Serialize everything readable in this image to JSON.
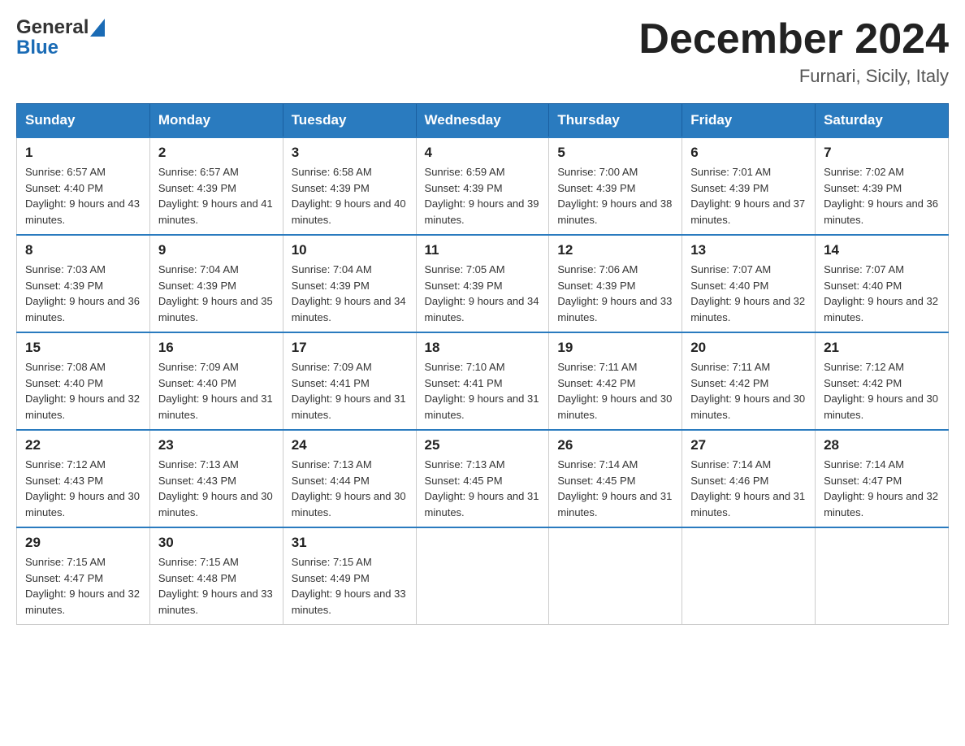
{
  "header": {
    "logo_text_general": "General",
    "logo_text_blue": "Blue",
    "month_title": "December 2024",
    "location": "Furnari, Sicily, Italy"
  },
  "days_of_week": [
    "Sunday",
    "Monday",
    "Tuesday",
    "Wednesday",
    "Thursday",
    "Friday",
    "Saturday"
  ],
  "weeks": [
    [
      {
        "day": "1",
        "sunrise": "Sunrise: 6:57 AM",
        "sunset": "Sunset: 4:40 PM",
        "daylight": "Daylight: 9 hours and 43 minutes."
      },
      {
        "day": "2",
        "sunrise": "Sunrise: 6:57 AM",
        "sunset": "Sunset: 4:39 PM",
        "daylight": "Daylight: 9 hours and 41 minutes."
      },
      {
        "day": "3",
        "sunrise": "Sunrise: 6:58 AM",
        "sunset": "Sunset: 4:39 PM",
        "daylight": "Daylight: 9 hours and 40 minutes."
      },
      {
        "day": "4",
        "sunrise": "Sunrise: 6:59 AM",
        "sunset": "Sunset: 4:39 PM",
        "daylight": "Daylight: 9 hours and 39 minutes."
      },
      {
        "day": "5",
        "sunrise": "Sunrise: 7:00 AM",
        "sunset": "Sunset: 4:39 PM",
        "daylight": "Daylight: 9 hours and 38 minutes."
      },
      {
        "day": "6",
        "sunrise": "Sunrise: 7:01 AM",
        "sunset": "Sunset: 4:39 PM",
        "daylight": "Daylight: 9 hours and 37 minutes."
      },
      {
        "day": "7",
        "sunrise": "Sunrise: 7:02 AM",
        "sunset": "Sunset: 4:39 PM",
        "daylight": "Daylight: 9 hours and 36 minutes."
      }
    ],
    [
      {
        "day": "8",
        "sunrise": "Sunrise: 7:03 AM",
        "sunset": "Sunset: 4:39 PM",
        "daylight": "Daylight: 9 hours and 36 minutes."
      },
      {
        "day": "9",
        "sunrise": "Sunrise: 7:04 AM",
        "sunset": "Sunset: 4:39 PM",
        "daylight": "Daylight: 9 hours and 35 minutes."
      },
      {
        "day": "10",
        "sunrise": "Sunrise: 7:04 AM",
        "sunset": "Sunset: 4:39 PM",
        "daylight": "Daylight: 9 hours and 34 minutes."
      },
      {
        "day": "11",
        "sunrise": "Sunrise: 7:05 AM",
        "sunset": "Sunset: 4:39 PM",
        "daylight": "Daylight: 9 hours and 34 minutes."
      },
      {
        "day": "12",
        "sunrise": "Sunrise: 7:06 AM",
        "sunset": "Sunset: 4:39 PM",
        "daylight": "Daylight: 9 hours and 33 minutes."
      },
      {
        "day": "13",
        "sunrise": "Sunrise: 7:07 AM",
        "sunset": "Sunset: 4:40 PM",
        "daylight": "Daylight: 9 hours and 32 minutes."
      },
      {
        "day": "14",
        "sunrise": "Sunrise: 7:07 AM",
        "sunset": "Sunset: 4:40 PM",
        "daylight": "Daylight: 9 hours and 32 minutes."
      }
    ],
    [
      {
        "day": "15",
        "sunrise": "Sunrise: 7:08 AM",
        "sunset": "Sunset: 4:40 PM",
        "daylight": "Daylight: 9 hours and 32 minutes."
      },
      {
        "day": "16",
        "sunrise": "Sunrise: 7:09 AM",
        "sunset": "Sunset: 4:40 PM",
        "daylight": "Daylight: 9 hours and 31 minutes."
      },
      {
        "day": "17",
        "sunrise": "Sunrise: 7:09 AM",
        "sunset": "Sunset: 4:41 PM",
        "daylight": "Daylight: 9 hours and 31 minutes."
      },
      {
        "day": "18",
        "sunrise": "Sunrise: 7:10 AM",
        "sunset": "Sunset: 4:41 PM",
        "daylight": "Daylight: 9 hours and 31 minutes."
      },
      {
        "day": "19",
        "sunrise": "Sunrise: 7:11 AM",
        "sunset": "Sunset: 4:42 PM",
        "daylight": "Daylight: 9 hours and 30 minutes."
      },
      {
        "day": "20",
        "sunrise": "Sunrise: 7:11 AM",
        "sunset": "Sunset: 4:42 PM",
        "daylight": "Daylight: 9 hours and 30 minutes."
      },
      {
        "day": "21",
        "sunrise": "Sunrise: 7:12 AM",
        "sunset": "Sunset: 4:42 PM",
        "daylight": "Daylight: 9 hours and 30 minutes."
      }
    ],
    [
      {
        "day": "22",
        "sunrise": "Sunrise: 7:12 AM",
        "sunset": "Sunset: 4:43 PM",
        "daylight": "Daylight: 9 hours and 30 minutes."
      },
      {
        "day": "23",
        "sunrise": "Sunrise: 7:13 AM",
        "sunset": "Sunset: 4:43 PM",
        "daylight": "Daylight: 9 hours and 30 minutes."
      },
      {
        "day": "24",
        "sunrise": "Sunrise: 7:13 AM",
        "sunset": "Sunset: 4:44 PM",
        "daylight": "Daylight: 9 hours and 30 minutes."
      },
      {
        "day": "25",
        "sunrise": "Sunrise: 7:13 AM",
        "sunset": "Sunset: 4:45 PM",
        "daylight": "Daylight: 9 hours and 31 minutes."
      },
      {
        "day": "26",
        "sunrise": "Sunrise: 7:14 AM",
        "sunset": "Sunset: 4:45 PM",
        "daylight": "Daylight: 9 hours and 31 minutes."
      },
      {
        "day": "27",
        "sunrise": "Sunrise: 7:14 AM",
        "sunset": "Sunset: 4:46 PM",
        "daylight": "Daylight: 9 hours and 31 minutes."
      },
      {
        "day": "28",
        "sunrise": "Sunrise: 7:14 AM",
        "sunset": "Sunset: 4:47 PM",
        "daylight": "Daylight: 9 hours and 32 minutes."
      }
    ],
    [
      {
        "day": "29",
        "sunrise": "Sunrise: 7:15 AM",
        "sunset": "Sunset: 4:47 PM",
        "daylight": "Daylight: 9 hours and 32 minutes."
      },
      {
        "day": "30",
        "sunrise": "Sunrise: 7:15 AM",
        "sunset": "Sunset: 4:48 PM",
        "daylight": "Daylight: 9 hours and 33 minutes."
      },
      {
        "day": "31",
        "sunrise": "Sunrise: 7:15 AM",
        "sunset": "Sunset: 4:49 PM",
        "daylight": "Daylight: 9 hours and 33 minutes."
      },
      null,
      null,
      null,
      null
    ]
  ]
}
